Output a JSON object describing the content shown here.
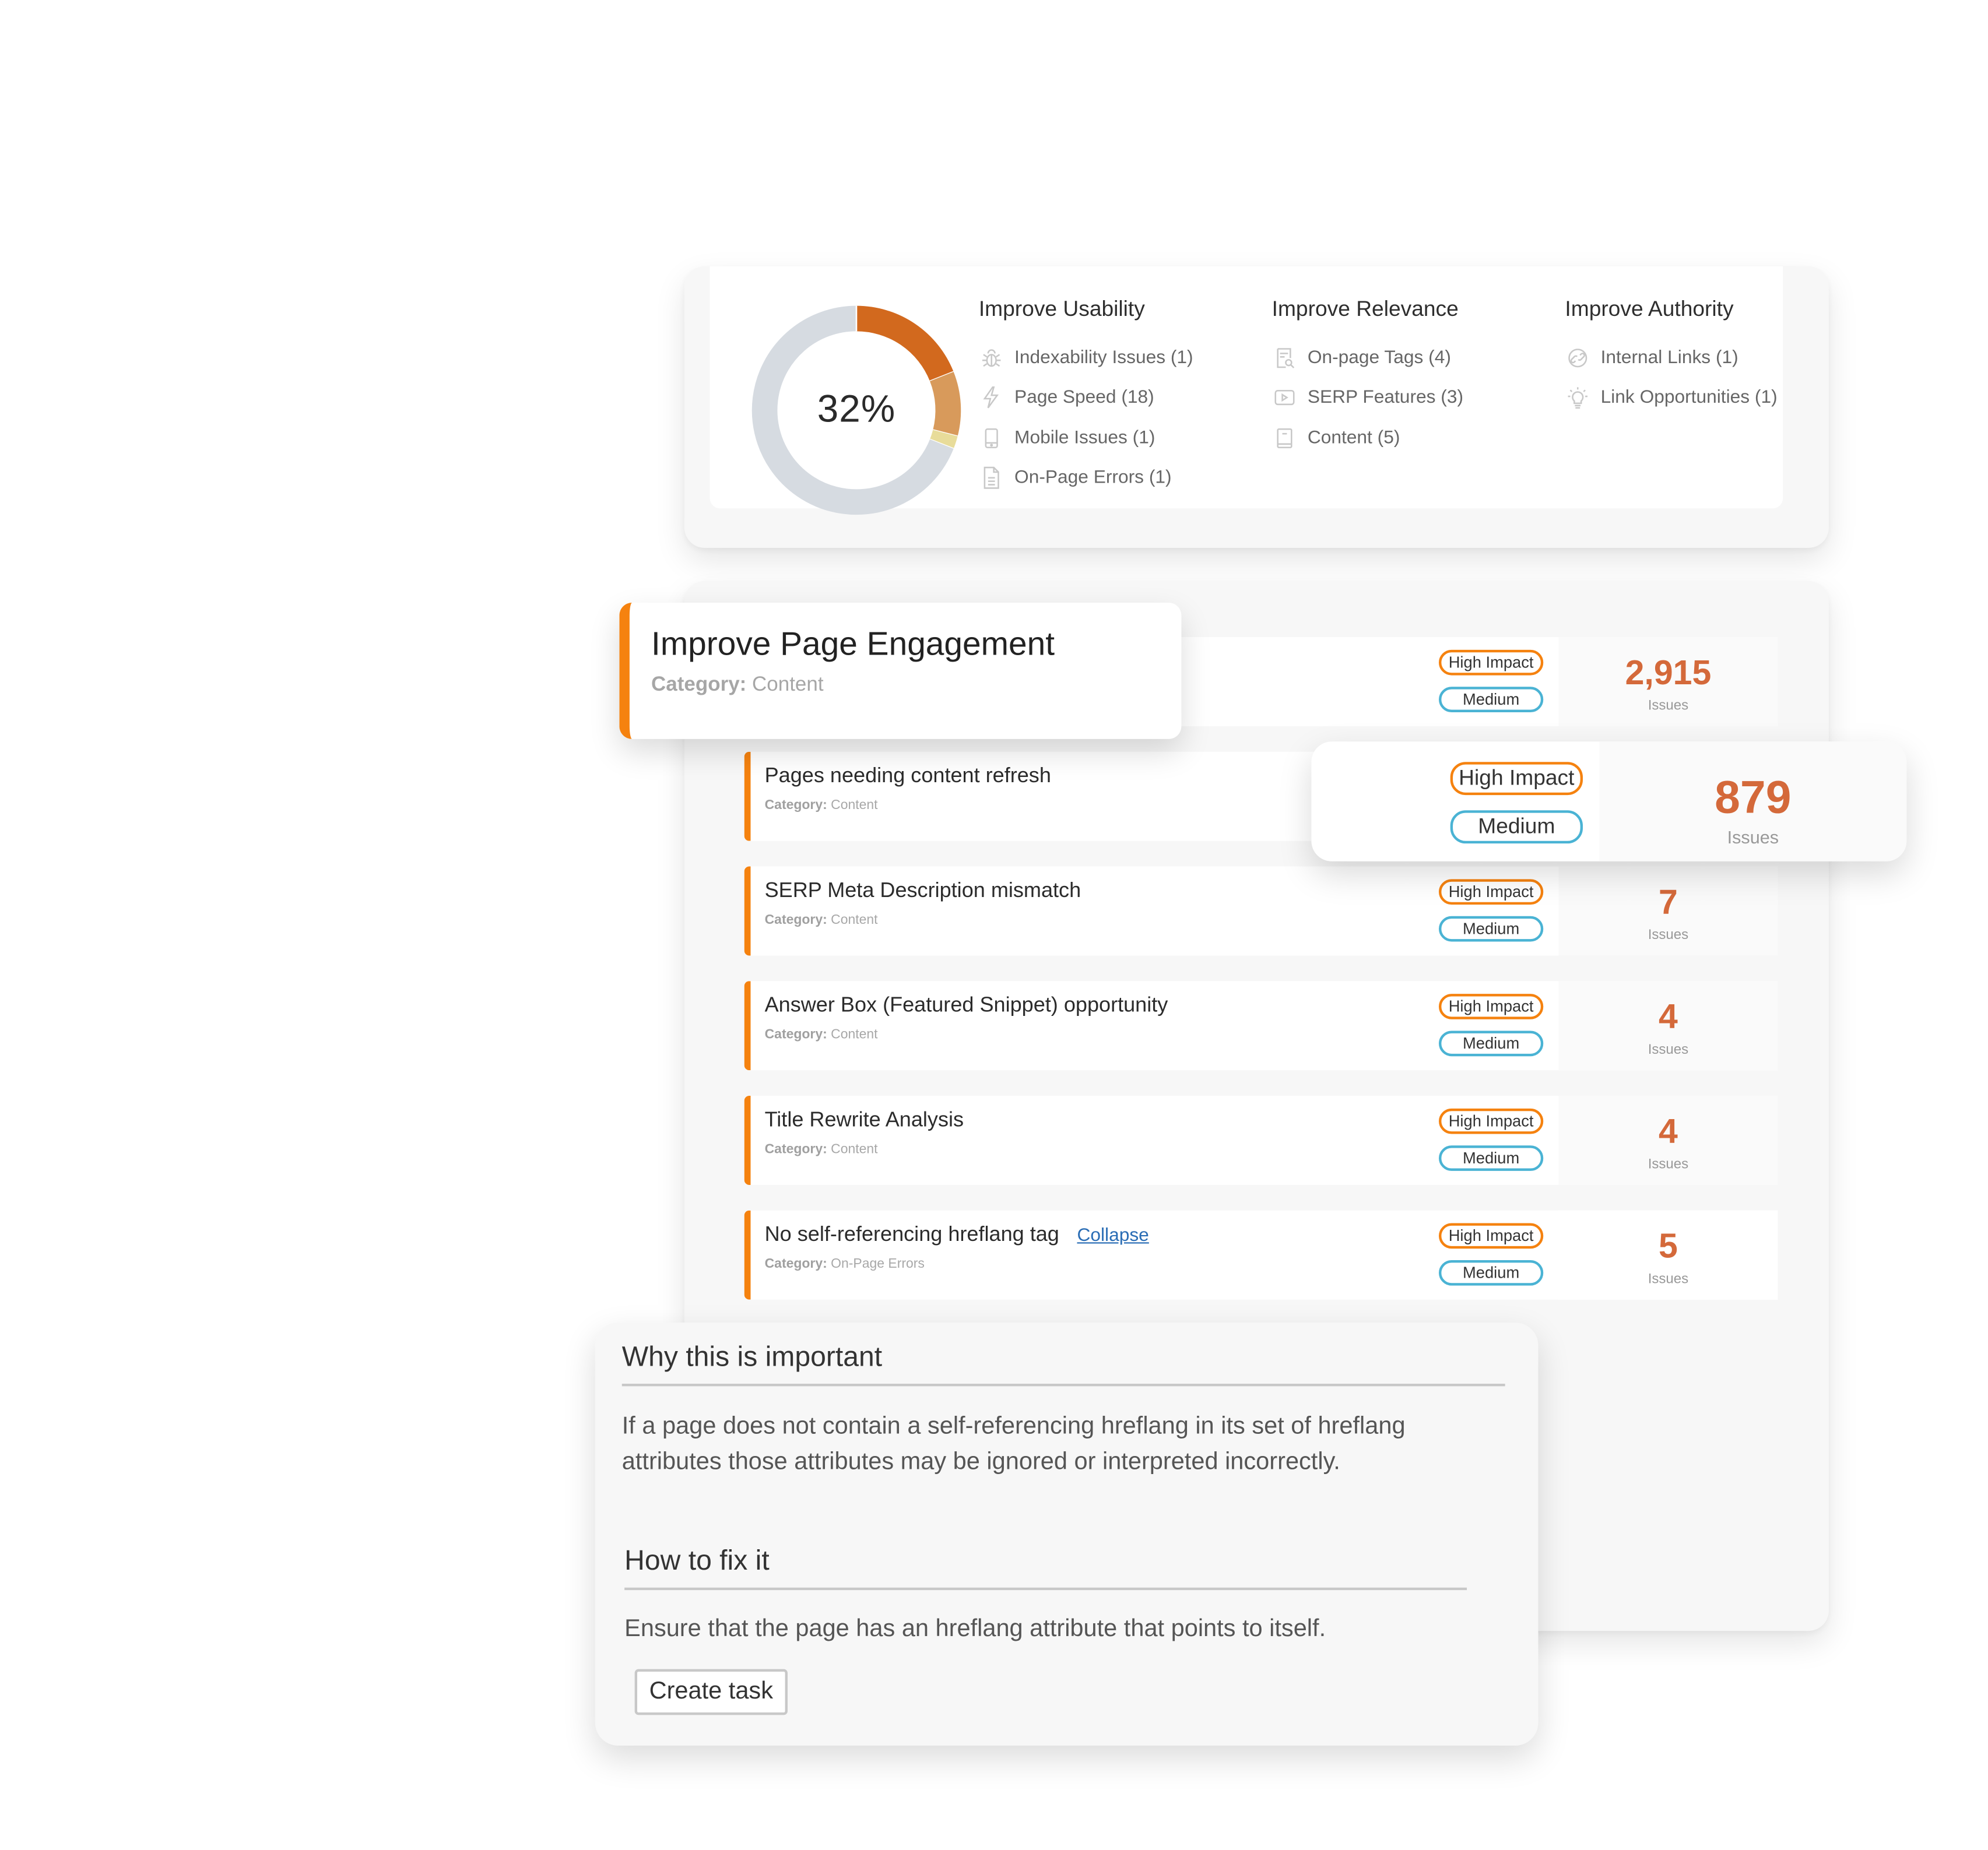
{
  "summary": {
    "score_label": "32%",
    "score_percent": 32,
    "donut_segments": [
      {
        "name": "segment-primary",
        "fraction": 0.19,
        "color": "#d2691e"
      },
      {
        "name": "segment-secondary",
        "fraction": 0.1,
        "color": "#d89a5b"
      },
      {
        "name": "segment-tertiary",
        "fraction": 0.02,
        "color": "#e8dc9a"
      },
      {
        "name": "segment-remaining",
        "fraction": 0.69,
        "color": "#d6dbe1"
      }
    ],
    "columns": [
      {
        "heading": "Improve Usability",
        "items": [
          {
            "label": "Indexability Issues (1)",
            "icon": "bug-icon"
          },
          {
            "label": "Page Speed (18)",
            "icon": "lightning-icon"
          },
          {
            "label": "Mobile Issues (1)",
            "icon": "mobile-icon"
          },
          {
            "label": "On-Page Errors (1)",
            "icon": "document-icon"
          }
        ]
      },
      {
        "heading": "Improve Relevance",
        "items": [
          {
            "label": "On-page Tags (4)",
            "icon": "tag-search-icon"
          },
          {
            "label": "SERP Features (3)",
            "icon": "play-box-icon"
          },
          {
            "label": "Content (5)",
            "icon": "page-icon"
          }
        ]
      },
      {
        "heading": "Improve Authority",
        "items": [
          {
            "label": "Internal Links (1)",
            "icon": "link-icon"
          },
          {
            "label": "Link Opportunities (1)",
            "icon": "lightbulb-icon"
          }
        ]
      }
    ]
  },
  "engagement": {
    "title": "Improve Page Engagement",
    "category_label": "Category:",
    "category_value": "Content",
    "impact": "High Impact",
    "level": "Medium",
    "count": "2,915",
    "count_label": "Issues"
  },
  "highlight": {
    "impact": "High Impact",
    "level": "Medium",
    "count": "879",
    "count_label": "Issues"
  },
  "rows": [
    {
      "title": "Pages needing content refresh",
      "category_label": "Category:",
      "category": "Content",
      "impact": "High Impact",
      "level": "Medium",
      "count": "879",
      "count_label": "Issues"
    },
    {
      "title": "SERP Meta Description mismatch",
      "category_label": "Category:",
      "category": "Content",
      "impact": "High Impact",
      "level": "Medium",
      "count": "7",
      "count_label": "Issues"
    },
    {
      "title": "Answer Box (Featured Snippet) opportunity",
      "category_label": "Category:",
      "category": "Content",
      "impact": "High Impact",
      "level": "Medium",
      "count": "4",
      "count_label": "Issues"
    },
    {
      "title": "Title Rewrite Analysis",
      "category_label": "Category:",
      "category": "Content",
      "impact": "High Impact",
      "level": "Medium",
      "count": "4",
      "count_label": "Issues"
    },
    {
      "title": "No self-referencing hreflang tag",
      "link": "Collapse",
      "category_label": "Category:",
      "category": "On-Page Errors",
      "impact": "High Impact",
      "level": "Medium",
      "count": "5",
      "count_label": "Issues"
    }
  ],
  "detail": {
    "why_heading": "Why this is important",
    "why_text": "If a page does not contain a self-referencing hreflang in its set of hreflang attributes those attributes may be ignored or interpreted incorrectly.",
    "fix_heading": "How to fix it",
    "fix_text": "Ensure that the page has an hreflang attribute that points to itself.",
    "button_label": "Create task"
  },
  "colors": {
    "accent_orange": "#f5820f",
    "count_orange": "#d4693a",
    "medium_blue": "#4ab3d4",
    "link_blue": "#2a6db5"
  }
}
